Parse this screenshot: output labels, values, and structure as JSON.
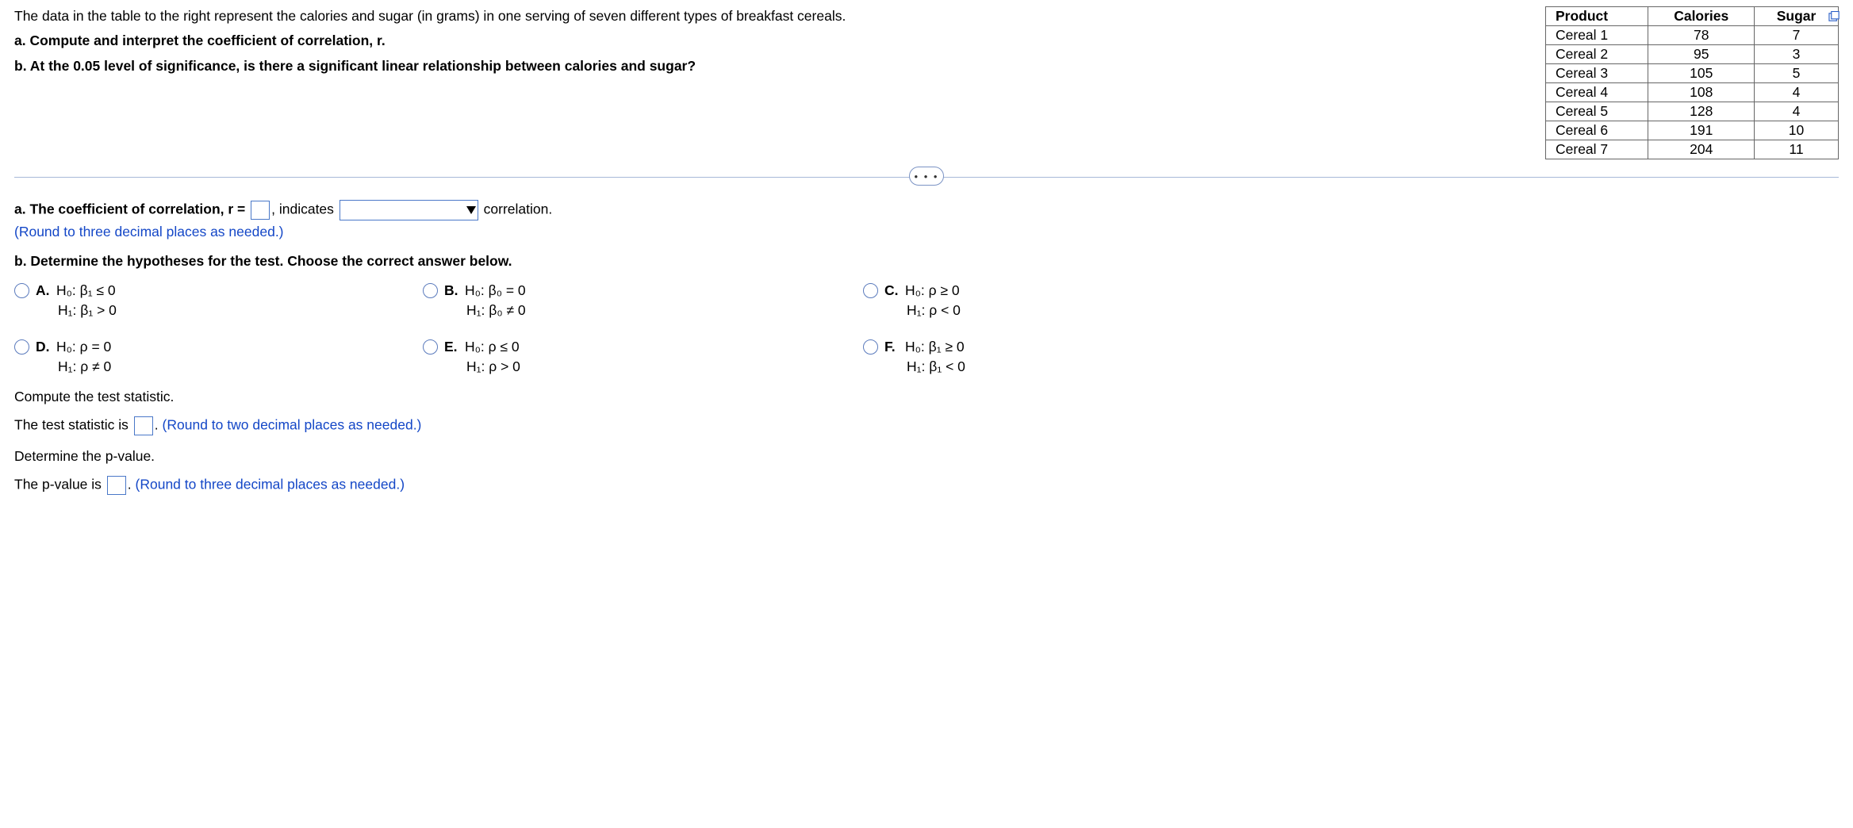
{
  "intro": {
    "p1": "The data in the table to the right represent the calories and sugar (in grams) in one serving of seven different types of breakfast cereals.",
    "a": "a. Compute and interpret the coefficient of correlation, r.",
    "b": "b. At the 0.05 level of significance, is there a significant linear relationship between calories and sugar?"
  },
  "table": {
    "headers": {
      "product": "Product",
      "calories": "Calories",
      "sugar": "Sugar"
    },
    "rows": [
      {
        "product": "Cereal 1",
        "calories": "78",
        "sugar": "7"
      },
      {
        "product": "Cereal 2",
        "calories": "95",
        "sugar": "3"
      },
      {
        "product": "Cereal 3",
        "calories": "105",
        "sugar": "5"
      },
      {
        "product": "Cereal 4",
        "calories": "108",
        "sugar": "4"
      },
      {
        "product": "Cereal 5",
        "calories": "128",
        "sugar": "4"
      },
      {
        "product": "Cereal 6",
        "calories": "191",
        "sugar": "10"
      },
      {
        "product": "Cereal 7",
        "calories": "204",
        "sugar": "11"
      }
    ]
  },
  "more_label": "• • •",
  "partA": {
    "lead": "a. The coefficient of correlation, r =",
    "mid": ", indicates",
    "tail": " correlation.",
    "round_note": "(Round to three decimal places as needed.)"
  },
  "partB": {
    "prompt": "b. Determine the hypotheses for the test. Choose the correct answer below.",
    "choices": {
      "A": {
        "letter": "A.",
        "h0": "H₀: β₁ ≤ 0",
        "h1": "H₁: β₁ > 0"
      },
      "B": {
        "letter": "B.",
        "h0": "H₀: β₀ = 0",
        "h1": "H₁: β₀ ≠ 0"
      },
      "C": {
        "letter": "C.",
        "h0": "H₀: ρ ≥ 0",
        "h1": "H₁: ρ < 0"
      },
      "D": {
        "letter": "D.",
        "h0": "H₀: ρ = 0",
        "h1": "H₁: ρ ≠ 0"
      },
      "E": {
        "letter": "E.",
        "h0": "H₀: ρ ≤ 0",
        "h1": "H₁: ρ > 0"
      },
      "F": {
        "letter": "F.",
        "h0": "H₀: β₁ ≥ 0",
        "h1": "H₁: β₁ < 0"
      }
    }
  },
  "tstat": {
    "title": "Compute the test statistic.",
    "lead": "The test statistic is ",
    "tail": ". ",
    "note": "(Round to two decimal places as needed.)"
  },
  "pval": {
    "title": "Determine the p-value.",
    "lead": "The p-value is ",
    "tail": ". ",
    "note": "(Round to three decimal places as needed.)"
  }
}
